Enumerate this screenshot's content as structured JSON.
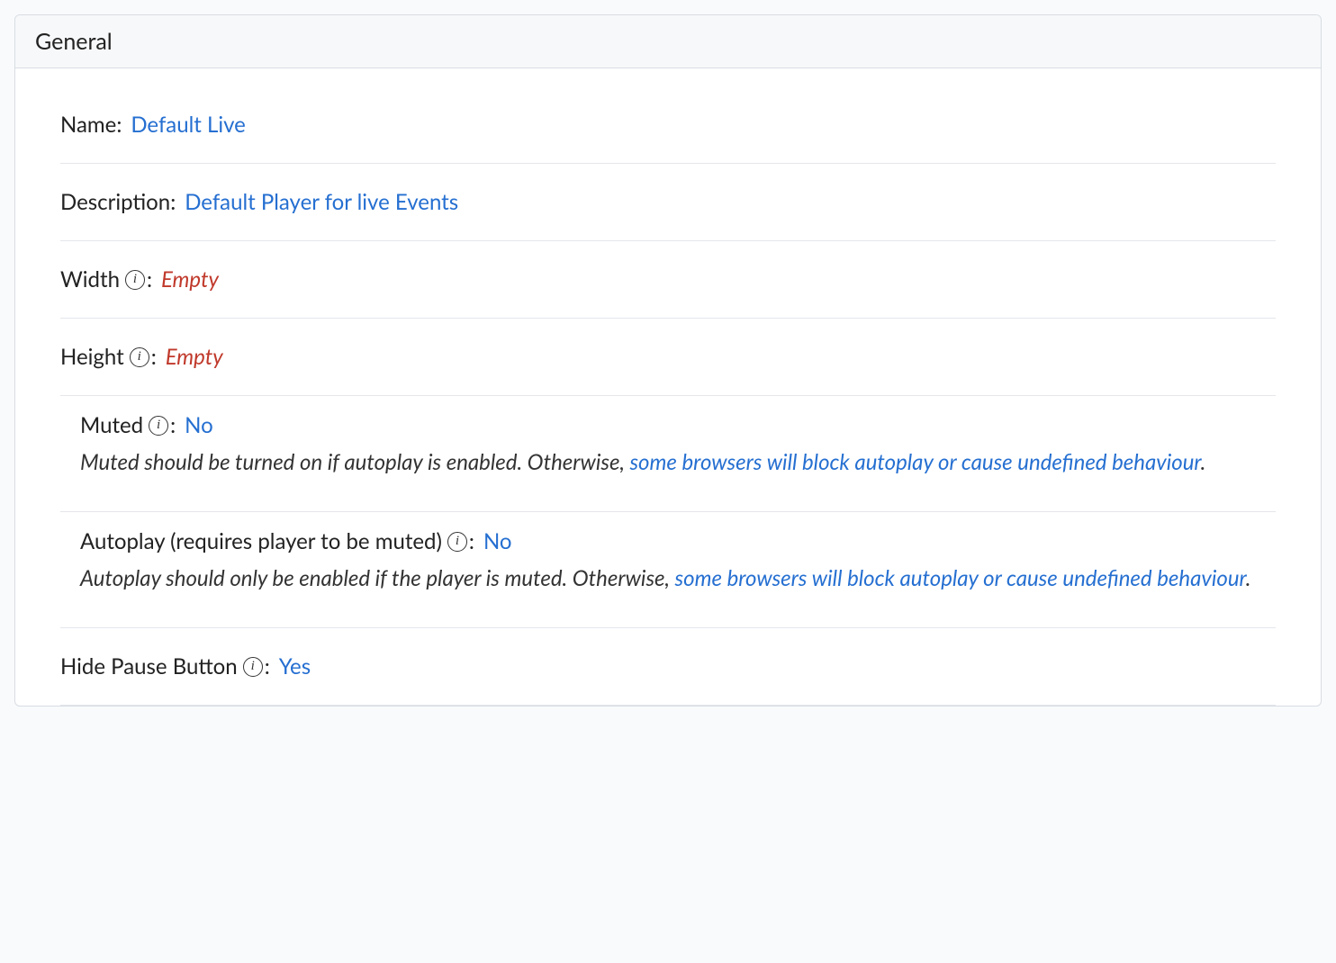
{
  "panel": {
    "title": "General"
  },
  "fields": {
    "name": {
      "label": "Name",
      "value": "Default Live"
    },
    "description": {
      "label": "Description",
      "value": "Default Player for live Events"
    },
    "width": {
      "label": "Width",
      "value": "Empty"
    },
    "height": {
      "label": "Height",
      "value": "Empty"
    },
    "muted": {
      "label": "Muted",
      "value": "No",
      "help_pre": "Muted should be turned on if autoplay is enabled. Otherwise, ",
      "help_link": "some browsers will block autoplay or cause undefined behaviour",
      "help_post": "."
    },
    "autoplay": {
      "label": "Autoplay (requires player to be muted)",
      "value": "No",
      "help_pre": "Autoplay should only be enabled if the player is muted. Otherwise, ",
      "help_link": "some browsers will block autoplay or cause undefined behaviour",
      "help_post": "."
    },
    "hidePause": {
      "label": "Hide Pause Button",
      "value": "Yes"
    }
  }
}
